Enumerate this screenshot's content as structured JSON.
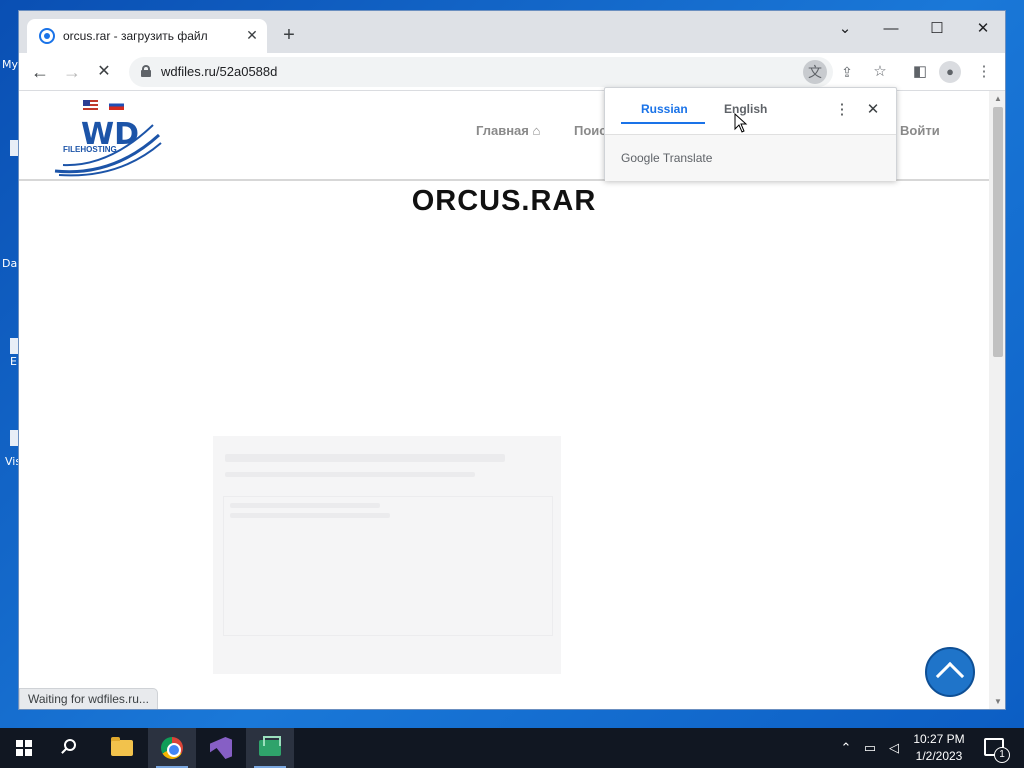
{
  "desktop": {
    "labels": [
      "My",
      "Da",
      "E",
      "Vis"
    ]
  },
  "browser": {
    "tab_title": "orcus.rar - загрузить файл",
    "tab_close": "✕",
    "new_tab": "+",
    "url": "wdfiles.ru/52a0588d",
    "window_controls": {
      "dropdown": "⌄",
      "minimize": "—",
      "maximize": "☐",
      "close": "✕"
    },
    "nav": {
      "back": "←",
      "forward": "→",
      "stop": "✕"
    },
    "status": "Waiting for wdfiles.ru..."
  },
  "site": {
    "logo_text": "WD",
    "logo_sub": "FILEHOSTING",
    "nav": {
      "home": "Главная ⌂",
      "search": "Поис",
      "login": "Войти"
    },
    "file_title": "ORCUS.RAR"
  },
  "translate": {
    "lang_source": "Russian",
    "lang_target": "English",
    "brand": "Google Translate",
    "menu_icon": "⋮",
    "close_icon": "✕"
  },
  "taskbar": {
    "time": "10:27 PM",
    "date": "1/2/2023",
    "notification_count": "1"
  },
  "colors": {
    "desktop_bg": "#1a78d8",
    "accent_blue": "#1a73e8",
    "site_blue": "#1c54a8",
    "scroll_top_bg": "#1f74c9"
  }
}
